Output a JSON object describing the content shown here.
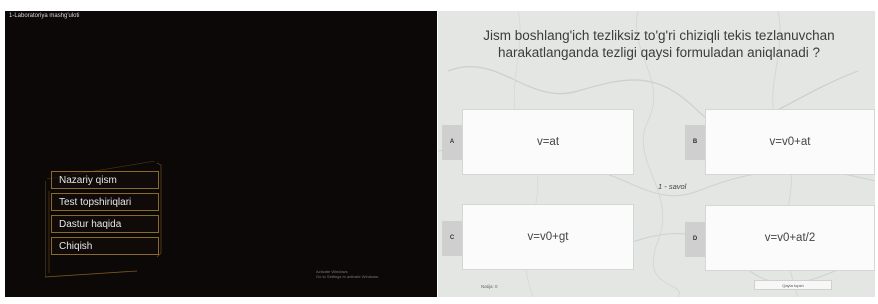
{
  "left_panel": {
    "window_title": "1-Laboratoriya mashg'uloti",
    "menu_items": [
      "Nazariy qism",
      "Test topshiriqlari",
      "Dastur haqida",
      "Chiqish"
    ],
    "watermark": [
      "Activate Windows",
      "Go to Settings to activate Windows."
    ]
  },
  "quiz": {
    "question": "Jism boshlang'ich tezliksiz to'g'ri chiziqli tekis tezlanuvchan harakatlanganda tezligi qaysi formuladan aniqlanadi ?",
    "answers": [
      {
        "letter": "A",
        "text": "v=at"
      },
      {
        "letter": "B",
        "text": "v=v0+at"
      },
      {
        "letter": "C",
        "text": "v=v0+gt"
      },
      {
        "letter": "D",
        "text": "v=v0+at/2"
      }
    ],
    "question_counter": "1 - savol",
    "result_label": "Natija: 0",
    "retry_button": "Qayta topsh"
  },
  "colors": {
    "left_bg": "#0b0807",
    "menu_border": "#8a6a2a",
    "quiz_bg": "#e3e6e2"
  }
}
